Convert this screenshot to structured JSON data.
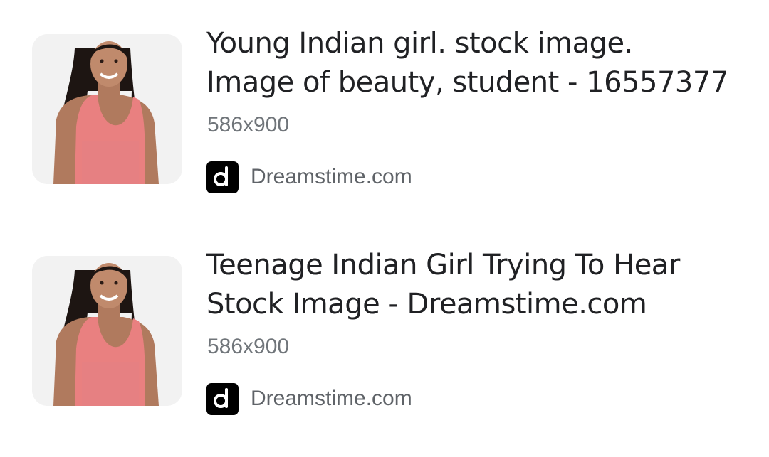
{
  "results": [
    {
      "title_line1": "Young Indian girl. stock image.",
      "title_line2": "Image of beauty, student - 16557377",
      "dimensions": "586x900",
      "source": "Dreamstime.com",
      "thumbnail_icon": "woman-pink-top-photo",
      "favicon_icon": "dreamstime-logo-icon"
    },
    {
      "title_line1": "Teenage Indian Girl Trying To Hear",
      "title_line2": "Stock Image - Dreamstime.com",
      "dimensions": "586x900",
      "source": "Dreamstime.com",
      "thumbnail_icon": "woman-pink-top-photo",
      "favicon_icon": "dreamstime-logo-icon"
    }
  ],
  "colors": {
    "title": "#202124",
    "meta": "#70757a",
    "source": "#5f6368",
    "thumb_bg": "#f1f1f1",
    "favicon_bg": "#000000"
  }
}
